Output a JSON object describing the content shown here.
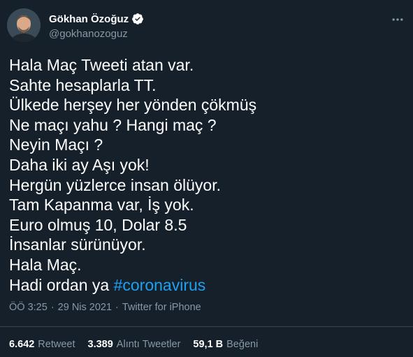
{
  "user": {
    "display_name": "Gökhan Özoğuz",
    "handle": "@gokhanozoguz",
    "verified_icon": "verified-badge-icon"
  },
  "tweet": {
    "lines": [
      "Hala Maç Tweeti atan var.",
      "Sahte hesaplarla TT.",
      "Ülkede herşey her yönden çökmüş",
      "Ne maçı yahu ? Hangi maç ?",
      "Neyin Maçı ?",
      "Daha iki ay Aşı yok!",
      "Hergün yüzlerce insan ölüyor.",
      "Tam Kapanma var, İş yok.",
      "Euro olmuş 10, Dolar 8.5",
      "İnsanlar sürünüyor.",
      "Hala Maç."
    ],
    "last_line_prefix": "Hadi ordan ya ",
    "hashtag": "#coronavirus"
  },
  "meta": {
    "time": "ÖÖ 3:25",
    "separator": "·",
    "date": "29 Nis 2021",
    "source": "Twitter for iPhone"
  },
  "stats": {
    "retweets": {
      "count": "6.642",
      "label": "Retweet"
    },
    "quotes": {
      "count": "3.389",
      "label": "Alıntı Tweetler"
    },
    "likes": {
      "count": "59,1 B",
      "label": "Beğeni"
    }
  },
  "colors": {
    "background": "#15202b",
    "text": "#ffffff",
    "secondary": "#8899a6",
    "accent": "#1da1f2",
    "divider": "#38444d"
  }
}
